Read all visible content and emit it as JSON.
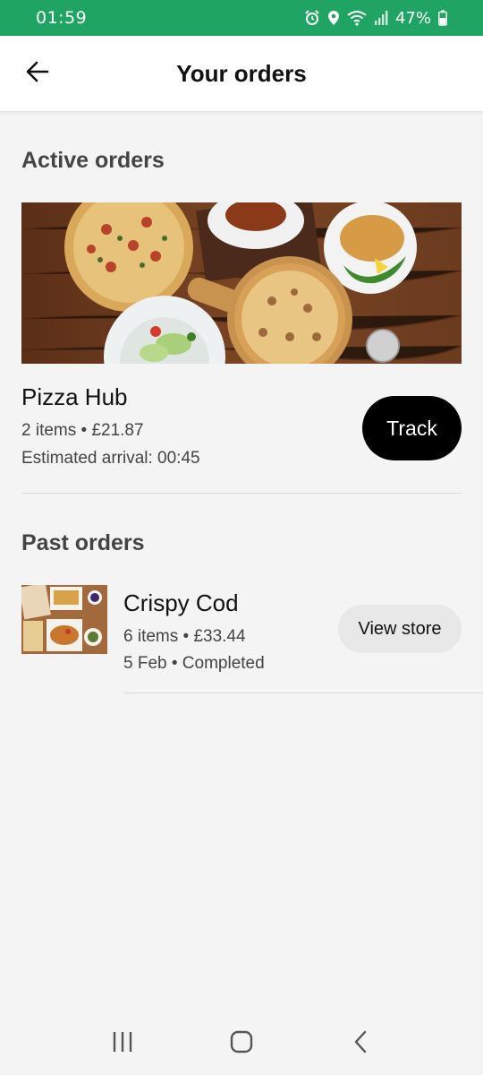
{
  "status_bar": {
    "time": "01:59",
    "battery": "47%",
    "icons": [
      "alarm-icon",
      "location-icon",
      "wifi-icon",
      "signal-icon",
      "battery-icon"
    ]
  },
  "header": {
    "title": "Your orders",
    "back_icon": "arrow-left-icon"
  },
  "active_orders": {
    "section_title": "Active orders",
    "order": {
      "image": "pizza-banner-image",
      "restaurant": "Pizza Hub",
      "summary": "2 items • £21.87",
      "eta": "Estimated arrival: 00:45",
      "action_label": "Track"
    }
  },
  "past_orders": {
    "section_title": "Past orders",
    "items": [
      {
        "image": "crispy-cod-thumbnail",
        "restaurant": "Crispy Cod",
        "summary": "6 items • £33.44",
        "status": "5 Feb • Completed",
        "action_label": "View store"
      }
    ]
  },
  "nav_bar": {
    "icons": [
      "recent-apps-icon",
      "home-icon",
      "back-icon"
    ]
  },
  "colors": {
    "status_bar": "#1fa463",
    "primary_button": "#000000",
    "secondary_button": "#e8e8e8",
    "background": "#f4f4f4"
  }
}
